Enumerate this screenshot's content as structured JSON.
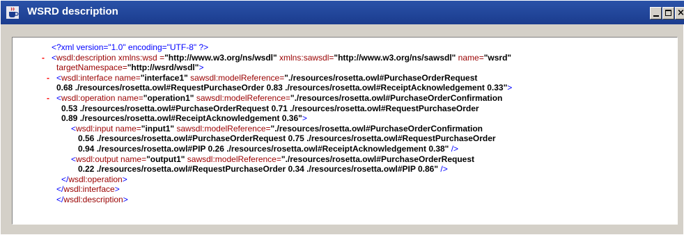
{
  "window": {
    "title": "WSRD description",
    "icon": "java-coffee-cup-icon",
    "buttons": [
      "minimize",
      "maximize",
      "close"
    ]
  },
  "xml_lines": [
    {
      "indent": 0,
      "minus": false,
      "parts": [
        [
          "pi",
          "<?xml version=\"1.0\" encoding=\"UTF-8\" ?>"
        ]
      ]
    },
    {
      "indent": 0,
      "minus": true,
      "parts": [
        [
          "brack",
          "<"
        ],
        [
          "tag",
          "wsdl:description"
        ],
        [
          "attr",
          " xmlns:wsd ="
        ],
        [
          "val",
          "\"http://www.w3.org/ns/wsdl\""
        ],
        [
          "attr",
          " xmlns:sawsdl="
        ],
        [
          "val",
          "\"http://www.w3.org/ns/sawsdl\""
        ],
        [
          "attr",
          " name="
        ],
        [
          "val",
          "\"wsrd\""
        ]
      ]
    },
    {
      "indent": 1,
      "minus": false,
      "parts": [
        [
          "attr",
          "targetNamespace="
        ],
        [
          "val",
          "\"http://wsrd/wsdl\""
        ],
        [
          "brack",
          ">"
        ]
      ]
    },
    {
      "indent": 1,
      "minus": true,
      "parts": [
        [
          "brack",
          "<"
        ],
        [
          "tag",
          "wsdl:interface"
        ],
        [
          "attr",
          " name="
        ],
        [
          "val",
          "\"interface1\""
        ],
        [
          "attr",
          " sawsdl:modelReference="
        ],
        [
          "val",
          "\"./resources/rosetta.owl#PurchaseOrderRequest"
        ]
      ]
    },
    {
      "indent": 2,
      "minus": false,
      "parts": [
        [
          "val",
          "0.68 ./resources/rosetta.owl#RequestPurchaseOrder 0.83 ./resources/rosetta.owl#ReceiptAcknowledgement 0.33\""
        ],
        [
          "brack",
          ">"
        ]
      ]
    },
    {
      "indent": 2,
      "minus": true,
      "parts": [
        [
          "brack",
          "<"
        ],
        [
          "tag",
          "wsdl:operation"
        ],
        [
          "attr",
          " name="
        ],
        [
          "val",
          "\"operation1\""
        ],
        [
          "attr",
          " sawsdl:modelReference="
        ],
        [
          "val",
          "\"./resources/rosetta.owl#PurchaseOrderConfirmation"
        ]
      ]
    },
    {
      "indent": 3,
      "minus": false,
      "parts": [
        [
          "val",
          "0.53 ./resources/rosetta.owl#PurchaseOrderRequest 0.71 ./resources/rosetta.owl#RequestPurchaseOrder"
        ]
      ]
    },
    {
      "indent": 3,
      "minus": false,
      "parts": [
        [
          "val",
          "0.89 ./resources/rosetta.owl#ReceiptAcknowledgement 0.36\""
        ],
        [
          "brack",
          ">"
        ]
      ]
    },
    {
      "indent": 4,
      "minus": false,
      "parts": [
        [
          "brack",
          "<"
        ],
        [
          "tag",
          "wsdl:input"
        ],
        [
          "attr",
          " name="
        ],
        [
          "val",
          "\"input1\""
        ],
        [
          "attr",
          " sawsdl:modelReference="
        ],
        [
          "val",
          "\"./resources/rosetta.owl#PurchaseOrderConfirmation"
        ]
      ]
    },
    {
      "indent": 5,
      "minus": false,
      "parts": [
        [
          "val",
          "0.56 ./resources/rosetta.owl#PurchaseOrderRequest 0.75 ./resources/rosetta.owl#RequestPurchaseOrder"
        ]
      ]
    },
    {
      "indent": 5,
      "minus": false,
      "parts": [
        [
          "val",
          "0.94 ./resources/rosetta.owl#PIP 0.26 ./resources/rosetta.owl#ReceiptAcknowledgement 0.38\""
        ],
        [
          "brack",
          " />"
        ]
      ]
    },
    {
      "indent": 4,
      "minus": false,
      "parts": [
        [
          "brack",
          "<"
        ],
        [
          "tag",
          "wsdl:output"
        ],
        [
          "attr",
          " name="
        ],
        [
          "val",
          "\"output1\""
        ],
        [
          "attr",
          " sawsdl:modelReference="
        ],
        [
          "val",
          "\"./resources/rosetta.owl#PurchaseOrderRequest"
        ]
      ]
    },
    {
      "indent": 5,
      "minus": false,
      "parts": [
        [
          "val",
          "0.22 ./resources/rosetta.owl#RequestPurchaseOrder 0.34 ./resources/rosetta.owl#PIP 0.86\""
        ],
        [
          "brack",
          " />"
        ]
      ]
    },
    {
      "indent": 3,
      "minus": false,
      "parts": [
        [
          "brack",
          "</"
        ],
        [
          "tag",
          "wsdl:operation"
        ],
        [
          "brack",
          ">"
        ]
      ]
    },
    {
      "indent": 2,
      "minus": false,
      "parts": [
        [
          "brack",
          "</"
        ],
        [
          "tag",
          "wsdl:interface"
        ],
        [
          "brack",
          ">"
        ]
      ]
    },
    {
      "indent": 1,
      "minus": false,
      "parts": [
        [
          "brack",
          "</"
        ],
        [
          "tag",
          "wsdl:description"
        ],
        [
          "brack",
          ">"
        ]
      ]
    }
  ]
}
